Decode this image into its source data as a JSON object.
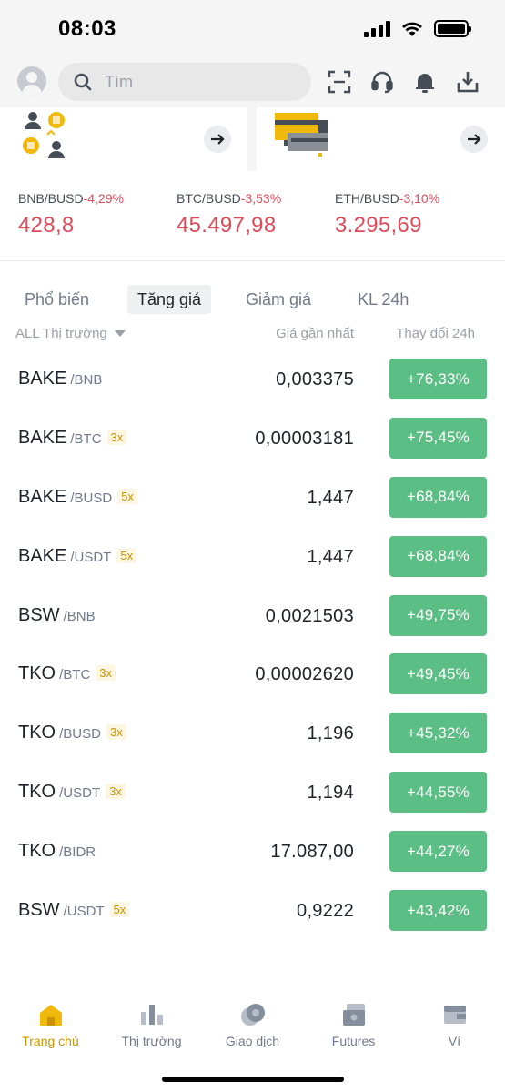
{
  "status": {
    "time": "08:03"
  },
  "search": {
    "placeholder": "Tìm"
  },
  "tickers": [
    {
      "pair": "BNB/BUSD",
      "change": "-4,29%",
      "price": "428,8"
    },
    {
      "pair": "BTC/BUSD",
      "change": "-3,53%",
      "price": "45.497,98"
    },
    {
      "pair": "ETH/BUSD",
      "change": "-3,10%",
      "price": "3.295,69"
    }
  ],
  "tabs": [
    {
      "label": "Phổ biến",
      "active": false
    },
    {
      "label": "Tăng giá",
      "active": true
    },
    {
      "label": "Giảm giá",
      "active": false
    },
    {
      "label": "KL 24h",
      "active": false
    }
  ],
  "columns": {
    "market": "ALL Thị trường",
    "price": "Giá gần nhất",
    "change": "Thay đổi 24h"
  },
  "rows": [
    {
      "base": "BAKE",
      "quote": "/BNB",
      "leverage": "",
      "price": "0,003375",
      "change": "+76,33%"
    },
    {
      "base": "BAKE",
      "quote": "/BTC",
      "leverage": "3x",
      "price": "0,00003181",
      "change": "+75,45%"
    },
    {
      "base": "BAKE",
      "quote": "/BUSD",
      "leverage": "5x",
      "price": "1,447",
      "change": "+68,84%"
    },
    {
      "base": "BAKE",
      "quote": "/USDT",
      "leverage": "5x",
      "price": "1,447",
      "change": "+68,84%"
    },
    {
      "base": "BSW",
      "quote": "/BNB",
      "leverage": "",
      "price": "0,0021503",
      "change": "+49,75%"
    },
    {
      "base": "TKO",
      "quote": "/BTC",
      "leverage": "3x",
      "price": "0,00002620",
      "change": "+49,45%"
    },
    {
      "base": "TKO",
      "quote": "/BUSD",
      "leverage": "3x",
      "price": "1,196",
      "change": "+45,32%"
    },
    {
      "base": "TKO",
      "quote": "/USDT",
      "leverage": "3x",
      "price": "1,194",
      "change": "+44,55%"
    },
    {
      "base": "TKO",
      "quote": "/BIDR",
      "leverage": "",
      "price": "17.087,00",
      "change": "+44,27%"
    },
    {
      "base": "BSW",
      "quote": "/USDT",
      "leverage": "5x",
      "price": "0,9222",
      "change": "+43,42%"
    }
  ],
  "nav": [
    {
      "label": "Trang chủ",
      "icon": "home-icon",
      "active": true
    },
    {
      "label": "Thị trường",
      "icon": "markets-chart-icon",
      "active": false
    },
    {
      "label": "Giao dịch",
      "icon": "trade-coins-icon",
      "active": false
    },
    {
      "label": "Futures",
      "icon": "futures-icon",
      "active": false
    },
    {
      "label": "Ví",
      "icon": "wallet-icon",
      "active": false
    }
  ],
  "colors": {
    "negative": "#e04b5a",
    "positive_bg": "#5bbe84",
    "accent": "#c99400",
    "muted": "#707a8a"
  }
}
